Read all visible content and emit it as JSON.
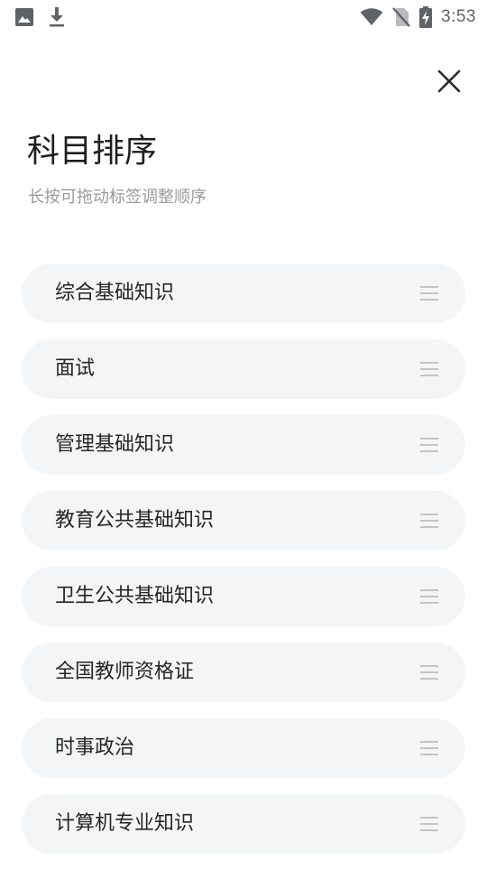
{
  "status_bar": {
    "time": "3:53",
    "icons": [
      "image-icon",
      "download-icon",
      "wifi-icon",
      "no-sim-icon",
      "battery-charging-icon"
    ]
  },
  "header": {
    "title": "科目排序",
    "subtitle": "长按可拖动标签调整顺序",
    "close_icon": "close-icon"
  },
  "subjects": [
    {
      "label": "综合基础知识"
    },
    {
      "label": "面试"
    },
    {
      "label": "管理基础知识"
    },
    {
      "label": "教育公共基础知识"
    },
    {
      "label": "卫生公共基础知识"
    },
    {
      "label": "全国教师资格证"
    },
    {
      "label": "时事政治"
    },
    {
      "label": "计算机专业知识"
    }
  ],
  "colors": {
    "background": "#ffffff",
    "item_background": "#f4f5f7",
    "title_text": "#1f1f1f",
    "subtitle_text": "#9a9a9a",
    "item_text": "#262626",
    "handle": "#c4c4c4",
    "status_icon": "#5f6368"
  }
}
